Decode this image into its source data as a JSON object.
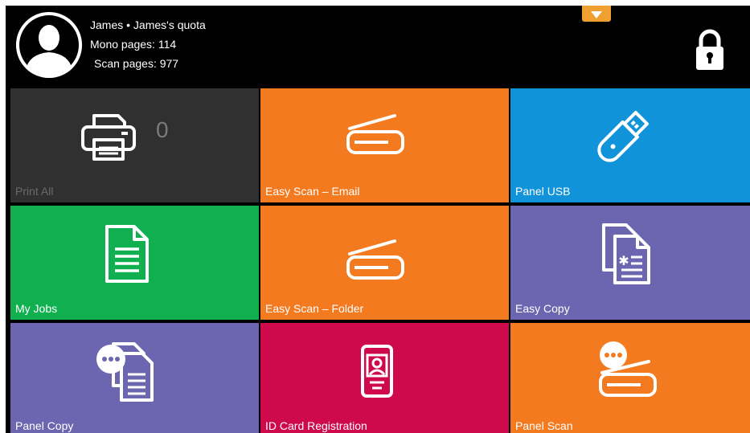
{
  "header": {
    "user_line": "James • James's quota",
    "mono_pages": "Mono pages: 114",
    "scan_pages": "Scan pages: 977"
  },
  "colors": {
    "dark_tile": "#303030",
    "orange": "#f47a20",
    "blue": "#1193d9",
    "green": "#10b050",
    "purple": "#6c66b0",
    "crimson": "#cf0a4c",
    "dropdown_tab": "#f0a030"
  },
  "tiles": [
    {
      "label": "Print All",
      "icon": "printer-icon",
      "count": "0"
    },
    {
      "label": "Easy Scan – Email",
      "icon": "scanner-icon"
    },
    {
      "label": "Panel USB",
      "icon": "usb-drive-icon"
    },
    {
      "label": "My Jobs",
      "icon": "document-icon"
    },
    {
      "label": "Easy Scan – Folder",
      "icon": "scanner-icon"
    },
    {
      "label": "Easy Copy",
      "icon": "copy-documents-icon"
    },
    {
      "label": "Panel Copy",
      "icon": "panel-copy-icon"
    },
    {
      "label": "ID Card Registration",
      "icon": "id-card-icon"
    },
    {
      "label": "Panel Scan",
      "icon": "panel-scan-icon"
    }
  ]
}
